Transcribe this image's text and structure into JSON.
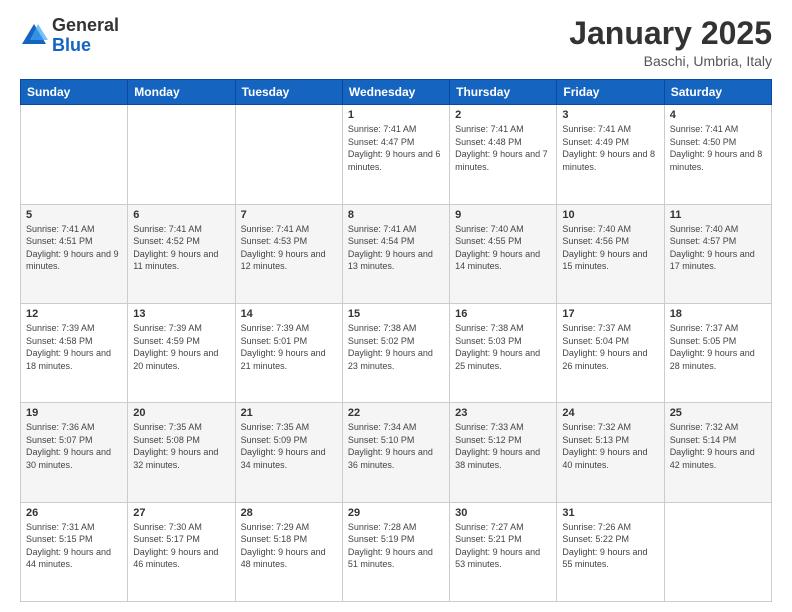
{
  "header": {
    "logo": {
      "general": "General",
      "blue": "Blue"
    },
    "title": "January 2025",
    "location": "Baschi, Umbria, Italy"
  },
  "days_of_week": [
    "Sunday",
    "Monday",
    "Tuesday",
    "Wednesday",
    "Thursday",
    "Friday",
    "Saturday"
  ],
  "weeks": [
    {
      "row_class": "row-1",
      "days": [
        {
          "num": "",
          "info": ""
        },
        {
          "num": "",
          "info": ""
        },
        {
          "num": "",
          "info": ""
        },
        {
          "num": "1",
          "info": "Sunrise: 7:41 AM\nSunset: 4:47 PM\nDaylight: 9 hours and 6 minutes."
        },
        {
          "num": "2",
          "info": "Sunrise: 7:41 AM\nSunset: 4:48 PM\nDaylight: 9 hours and 7 minutes."
        },
        {
          "num": "3",
          "info": "Sunrise: 7:41 AM\nSunset: 4:49 PM\nDaylight: 9 hours and 8 minutes."
        },
        {
          "num": "4",
          "info": "Sunrise: 7:41 AM\nSunset: 4:50 PM\nDaylight: 9 hours and 8 minutes."
        }
      ]
    },
    {
      "row_class": "row-2",
      "days": [
        {
          "num": "5",
          "info": "Sunrise: 7:41 AM\nSunset: 4:51 PM\nDaylight: 9 hours and 9 minutes."
        },
        {
          "num": "6",
          "info": "Sunrise: 7:41 AM\nSunset: 4:52 PM\nDaylight: 9 hours and 11 minutes."
        },
        {
          "num": "7",
          "info": "Sunrise: 7:41 AM\nSunset: 4:53 PM\nDaylight: 9 hours and 12 minutes."
        },
        {
          "num": "8",
          "info": "Sunrise: 7:41 AM\nSunset: 4:54 PM\nDaylight: 9 hours and 13 minutes."
        },
        {
          "num": "9",
          "info": "Sunrise: 7:40 AM\nSunset: 4:55 PM\nDaylight: 9 hours and 14 minutes."
        },
        {
          "num": "10",
          "info": "Sunrise: 7:40 AM\nSunset: 4:56 PM\nDaylight: 9 hours and 15 minutes."
        },
        {
          "num": "11",
          "info": "Sunrise: 7:40 AM\nSunset: 4:57 PM\nDaylight: 9 hours and 17 minutes."
        }
      ]
    },
    {
      "row_class": "row-3",
      "days": [
        {
          "num": "12",
          "info": "Sunrise: 7:39 AM\nSunset: 4:58 PM\nDaylight: 9 hours and 18 minutes."
        },
        {
          "num": "13",
          "info": "Sunrise: 7:39 AM\nSunset: 4:59 PM\nDaylight: 9 hours and 20 minutes."
        },
        {
          "num": "14",
          "info": "Sunrise: 7:39 AM\nSunset: 5:01 PM\nDaylight: 9 hours and 21 minutes."
        },
        {
          "num": "15",
          "info": "Sunrise: 7:38 AM\nSunset: 5:02 PM\nDaylight: 9 hours and 23 minutes."
        },
        {
          "num": "16",
          "info": "Sunrise: 7:38 AM\nSunset: 5:03 PM\nDaylight: 9 hours and 25 minutes."
        },
        {
          "num": "17",
          "info": "Sunrise: 7:37 AM\nSunset: 5:04 PM\nDaylight: 9 hours and 26 minutes."
        },
        {
          "num": "18",
          "info": "Sunrise: 7:37 AM\nSunset: 5:05 PM\nDaylight: 9 hours and 28 minutes."
        }
      ]
    },
    {
      "row_class": "row-4",
      "days": [
        {
          "num": "19",
          "info": "Sunrise: 7:36 AM\nSunset: 5:07 PM\nDaylight: 9 hours and 30 minutes."
        },
        {
          "num": "20",
          "info": "Sunrise: 7:35 AM\nSunset: 5:08 PM\nDaylight: 9 hours and 32 minutes."
        },
        {
          "num": "21",
          "info": "Sunrise: 7:35 AM\nSunset: 5:09 PM\nDaylight: 9 hours and 34 minutes."
        },
        {
          "num": "22",
          "info": "Sunrise: 7:34 AM\nSunset: 5:10 PM\nDaylight: 9 hours and 36 minutes."
        },
        {
          "num": "23",
          "info": "Sunrise: 7:33 AM\nSunset: 5:12 PM\nDaylight: 9 hours and 38 minutes."
        },
        {
          "num": "24",
          "info": "Sunrise: 7:32 AM\nSunset: 5:13 PM\nDaylight: 9 hours and 40 minutes."
        },
        {
          "num": "25",
          "info": "Sunrise: 7:32 AM\nSunset: 5:14 PM\nDaylight: 9 hours and 42 minutes."
        }
      ]
    },
    {
      "row_class": "row-5",
      "days": [
        {
          "num": "26",
          "info": "Sunrise: 7:31 AM\nSunset: 5:15 PM\nDaylight: 9 hours and 44 minutes."
        },
        {
          "num": "27",
          "info": "Sunrise: 7:30 AM\nSunset: 5:17 PM\nDaylight: 9 hours and 46 minutes."
        },
        {
          "num": "28",
          "info": "Sunrise: 7:29 AM\nSunset: 5:18 PM\nDaylight: 9 hours and 48 minutes."
        },
        {
          "num": "29",
          "info": "Sunrise: 7:28 AM\nSunset: 5:19 PM\nDaylight: 9 hours and 51 minutes."
        },
        {
          "num": "30",
          "info": "Sunrise: 7:27 AM\nSunset: 5:21 PM\nDaylight: 9 hours and 53 minutes."
        },
        {
          "num": "31",
          "info": "Sunrise: 7:26 AM\nSunset: 5:22 PM\nDaylight: 9 hours and 55 minutes."
        },
        {
          "num": "",
          "info": ""
        }
      ]
    }
  ]
}
